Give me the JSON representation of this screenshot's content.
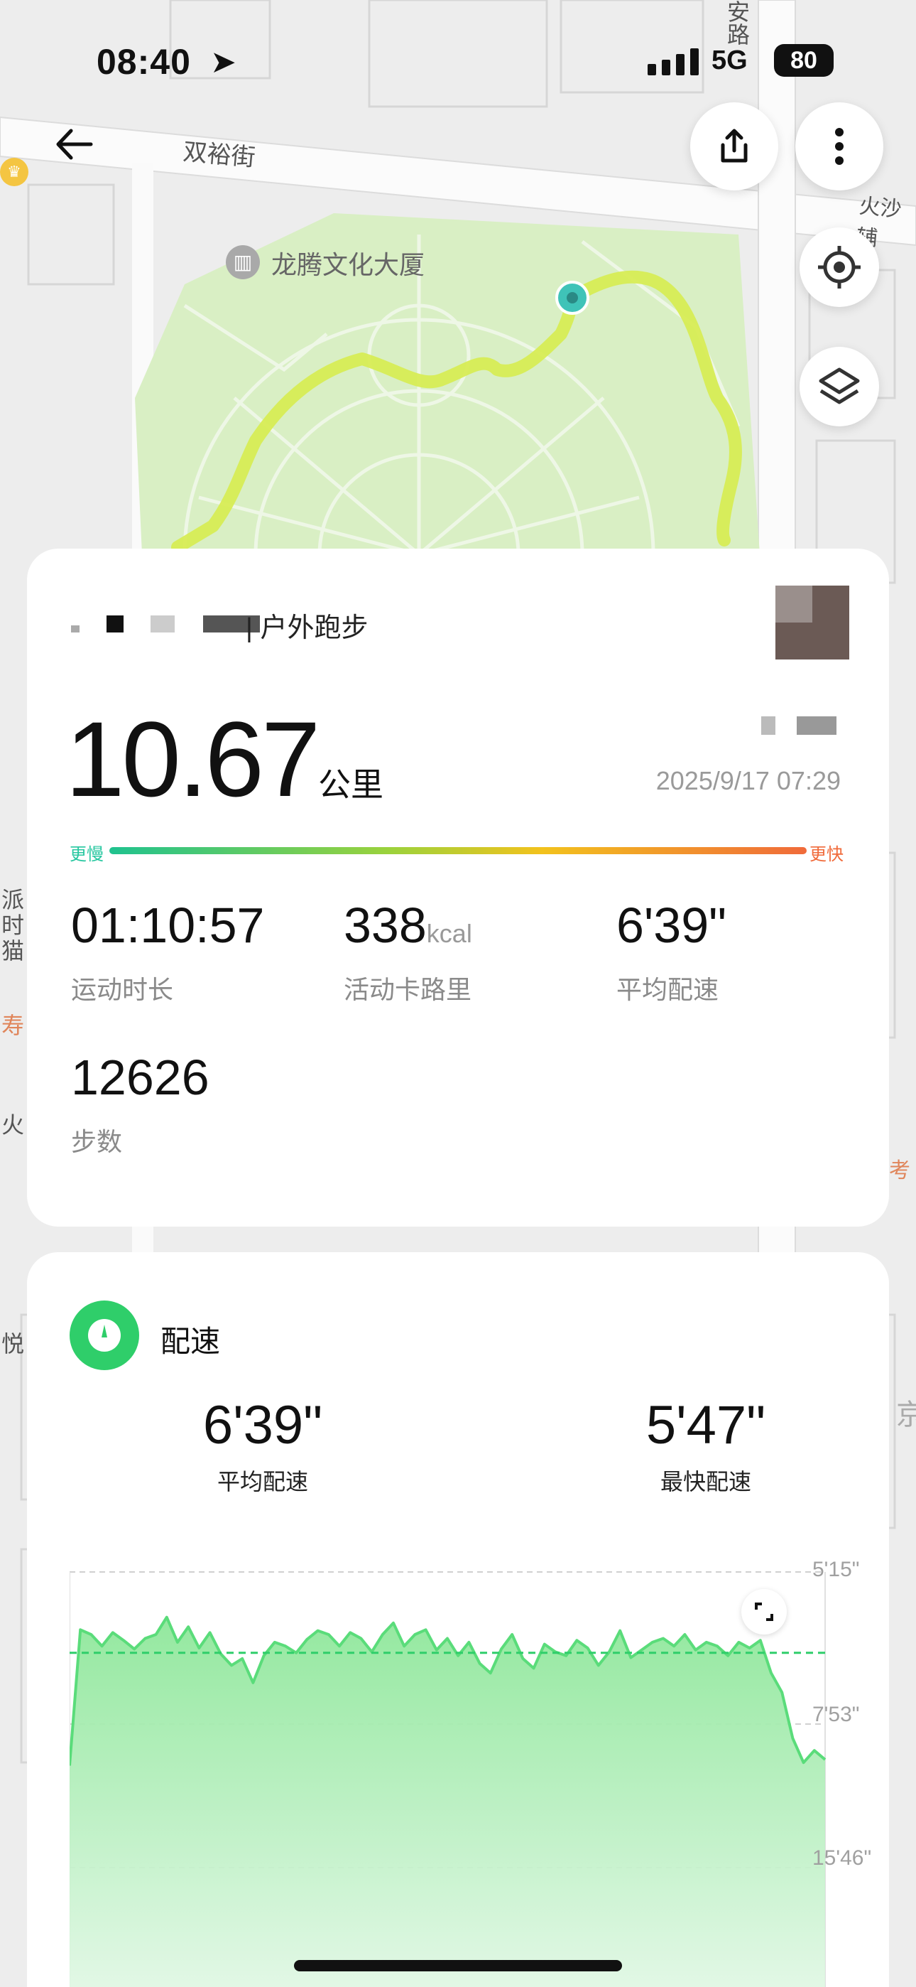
{
  "status": {
    "time": "08:40",
    "network": "5G",
    "battery": "80"
  },
  "map": {
    "labels": {
      "street1": "双裕街",
      "building": "龙腾文化大厦",
      "street2": "火沙辅",
      "road_vertical": "安路",
      "side1": "派",
      "side2": "时",
      "side3": "猫",
      "side4": "寿",
      "side5": "火",
      "side6": "考",
      "side7": "悦",
      "side8": "京"
    }
  },
  "summary": {
    "activity_type": "户外跑步",
    "distance_value": "10.67",
    "distance_unit": "公里",
    "datetime": "2025/9/17 07:29",
    "scale_slow": "更慢",
    "scale_fast": "更快",
    "stats": [
      {
        "value": "01:10:57",
        "unit": "",
        "label": "运动时长"
      },
      {
        "value": "338",
        "unit": "kcal",
        "label": "活动卡路里"
      },
      {
        "value": "6'39\"",
        "unit": "",
        "label": "平均配速"
      },
      {
        "value": "12626",
        "unit": "",
        "label": "步数"
      }
    ]
  },
  "pace": {
    "title": "配速",
    "avg_value": "6'39\"",
    "avg_label": "平均配速",
    "best_value": "5'47\"",
    "best_label": "最快配速",
    "accent": "#2fce6a",
    "chart_data": {
      "type": "area",
      "y_tick_labels": [
        "5'15\"",
        "7'53\"",
        "15'46\""
      ],
      "y_reversed": true,
      "reference_line": "6'39\"",
      "x": [
        0,
        1,
        2,
        3,
        4,
        5,
        6,
        7,
        8,
        9,
        10,
        11,
        12,
        13,
        14,
        15,
        16,
        17,
        18,
        19,
        20,
        21,
        22,
        23,
        24,
        25,
        26,
        27,
        28,
        29,
        30,
        31,
        32,
        33,
        34,
        35,
        36,
        37,
        38,
        39,
        40,
        41,
        42,
        43,
        44,
        45,
        46,
        47,
        48,
        49,
        50,
        51,
        52,
        53,
        54,
        55,
        56,
        57,
        58,
        59,
        60,
        61,
        62,
        63,
        64,
        65,
        66,
        67,
        68,
        69,
        70
      ],
      "values_sec_per_km": [
        610,
        375,
        380,
        392,
        378,
        386,
        395,
        384,
        380,
        362,
        388,
        372,
        394,
        378,
        400,
        412,
        405,
        430,
        402,
        388,
        392,
        399,
        385,
        376,
        380,
        392,
        378,
        384,
        398,
        380,
        368,
        392,
        380,
        375,
        396,
        384,
        402,
        388,
        410,
        420,
        395,
        380,
        405,
        415,
        390,
        398,
        402,
        386,
        394,
        412,
        398,
        376,
        404,
        396,
        388,
        384,
        392,
        380,
        396,
        388,
        392,
        402,
        388,
        394,
        386,
        420,
        440,
        520,
        600,
        560,
        590
      ]
    }
  },
  "colors": {
    "route": "#d7ec55",
    "route_start": "#3fc3b8",
    "slow": "#27c7a0",
    "fast": "#f06a3a",
    "park": "#d9efc4"
  }
}
